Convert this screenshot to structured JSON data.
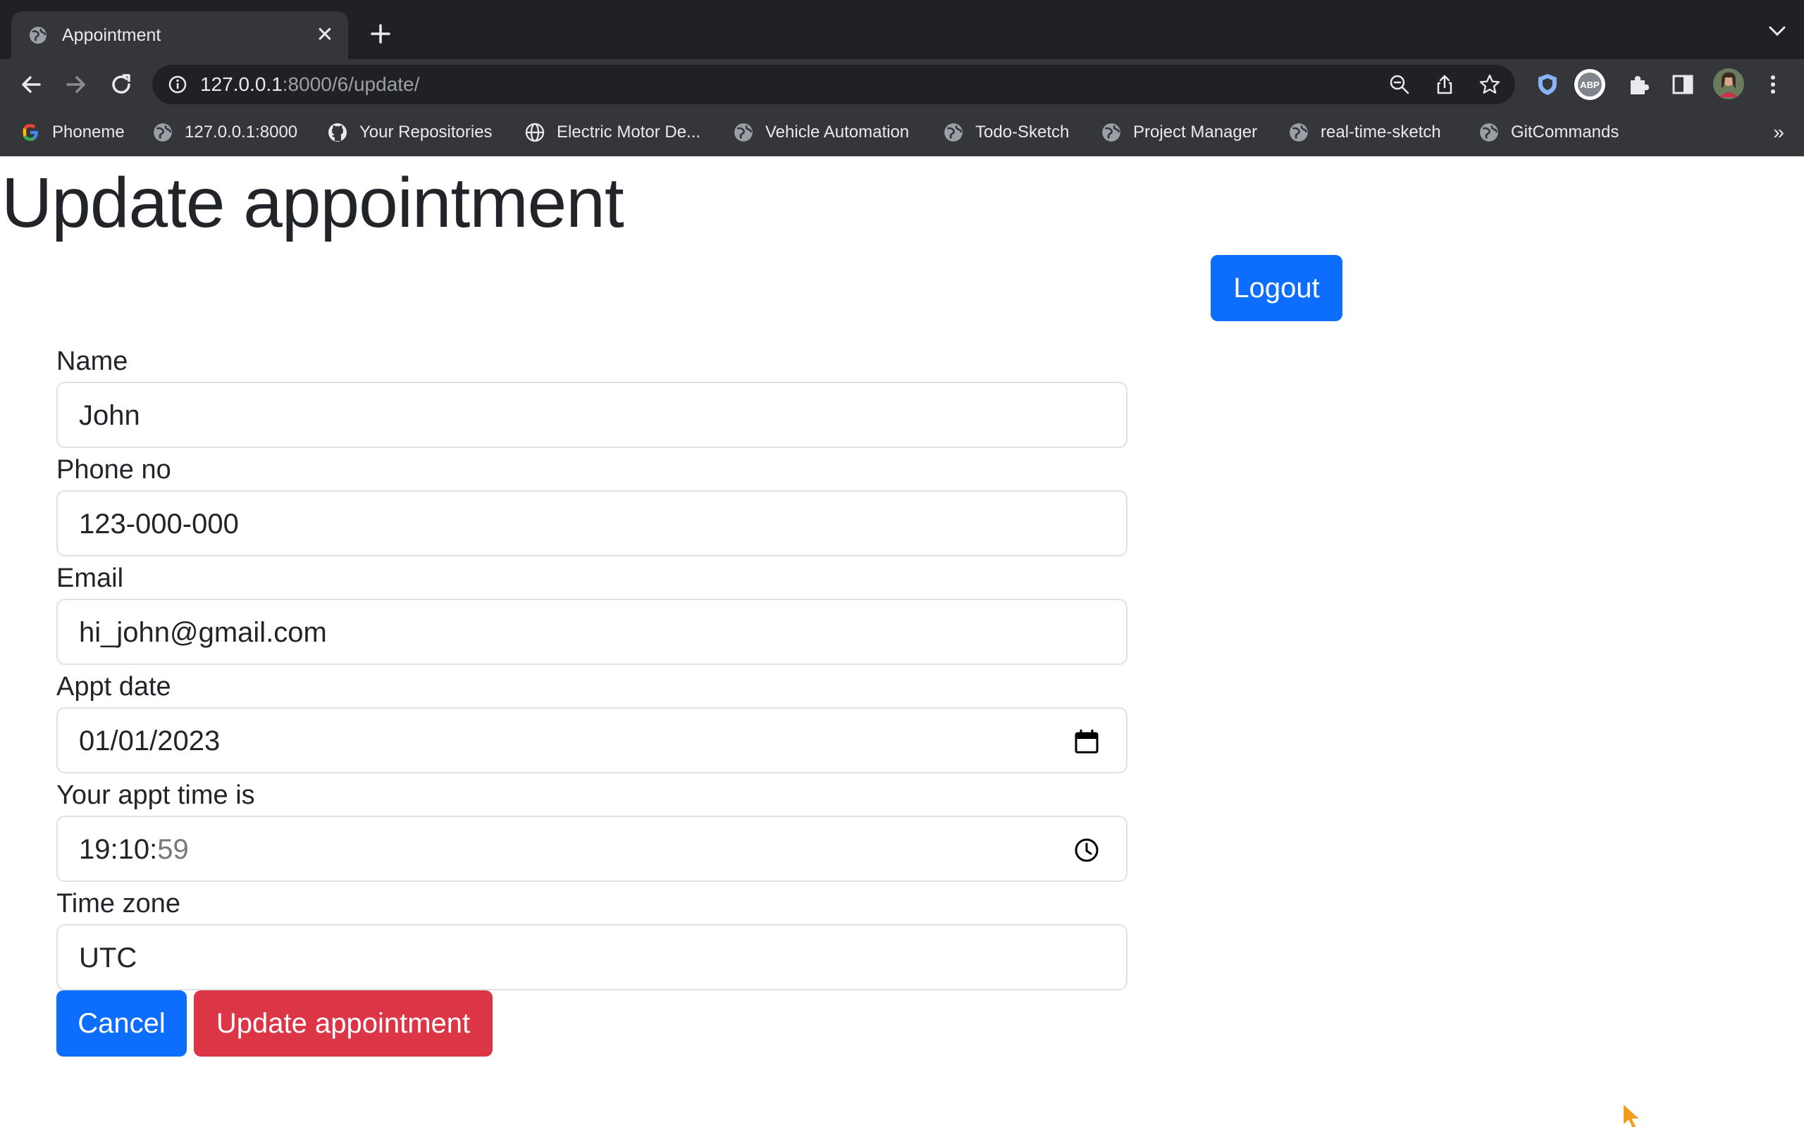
{
  "browser": {
    "tab": {
      "title": "Appointment",
      "close_label": "✕"
    },
    "address": {
      "host": "127.0.0.1",
      "path": ":8000/6/update/"
    },
    "bookmarks": [
      {
        "label": "Phoneme",
        "icon": "google-icon"
      },
      {
        "label": "127.0.0.1:8000",
        "icon": "globe-icon"
      },
      {
        "label": "Your Repositories",
        "icon": "github-icon"
      },
      {
        "label": "Electric Motor De...",
        "icon": "web-icon"
      },
      {
        "label": "Vehicle Automation",
        "icon": "globe-icon"
      },
      {
        "label": "Todo-Sketch",
        "icon": "globe-icon"
      },
      {
        "label": "Project Manager",
        "icon": "globe-icon"
      },
      {
        "label": "real-time-sketch",
        "icon": "globe-icon"
      },
      {
        "label": "GitCommands",
        "icon": "globe-icon"
      }
    ],
    "bookmarks_more": "»"
  },
  "page": {
    "title": "Update appointment",
    "logout_label": "Logout",
    "form": {
      "name_label": "Name",
      "name_value": "John",
      "phone_label": "Phone no",
      "phone_value": "123-000-000",
      "email_label": "Email",
      "email_value": "hi_john@gmail.com",
      "date_label": "Appt date",
      "date_value": "01/01/2023",
      "time_label": "Your appt time is",
      "time_value_main": "19:10:",
      "time_value_seconds": "59",
      "tz_label": "Time zone",
      "tz_value": "UTC"
    },
    "cancel_label": "Cancel",
    "update_label": "Update appointment"
  },
  "colors": {
    "primary": "#0d6efd",
    "danger": "#dc3545",
    "chrome_dark": "#202124",
    "chrome_toolbar": "#35363a"
  }
}
